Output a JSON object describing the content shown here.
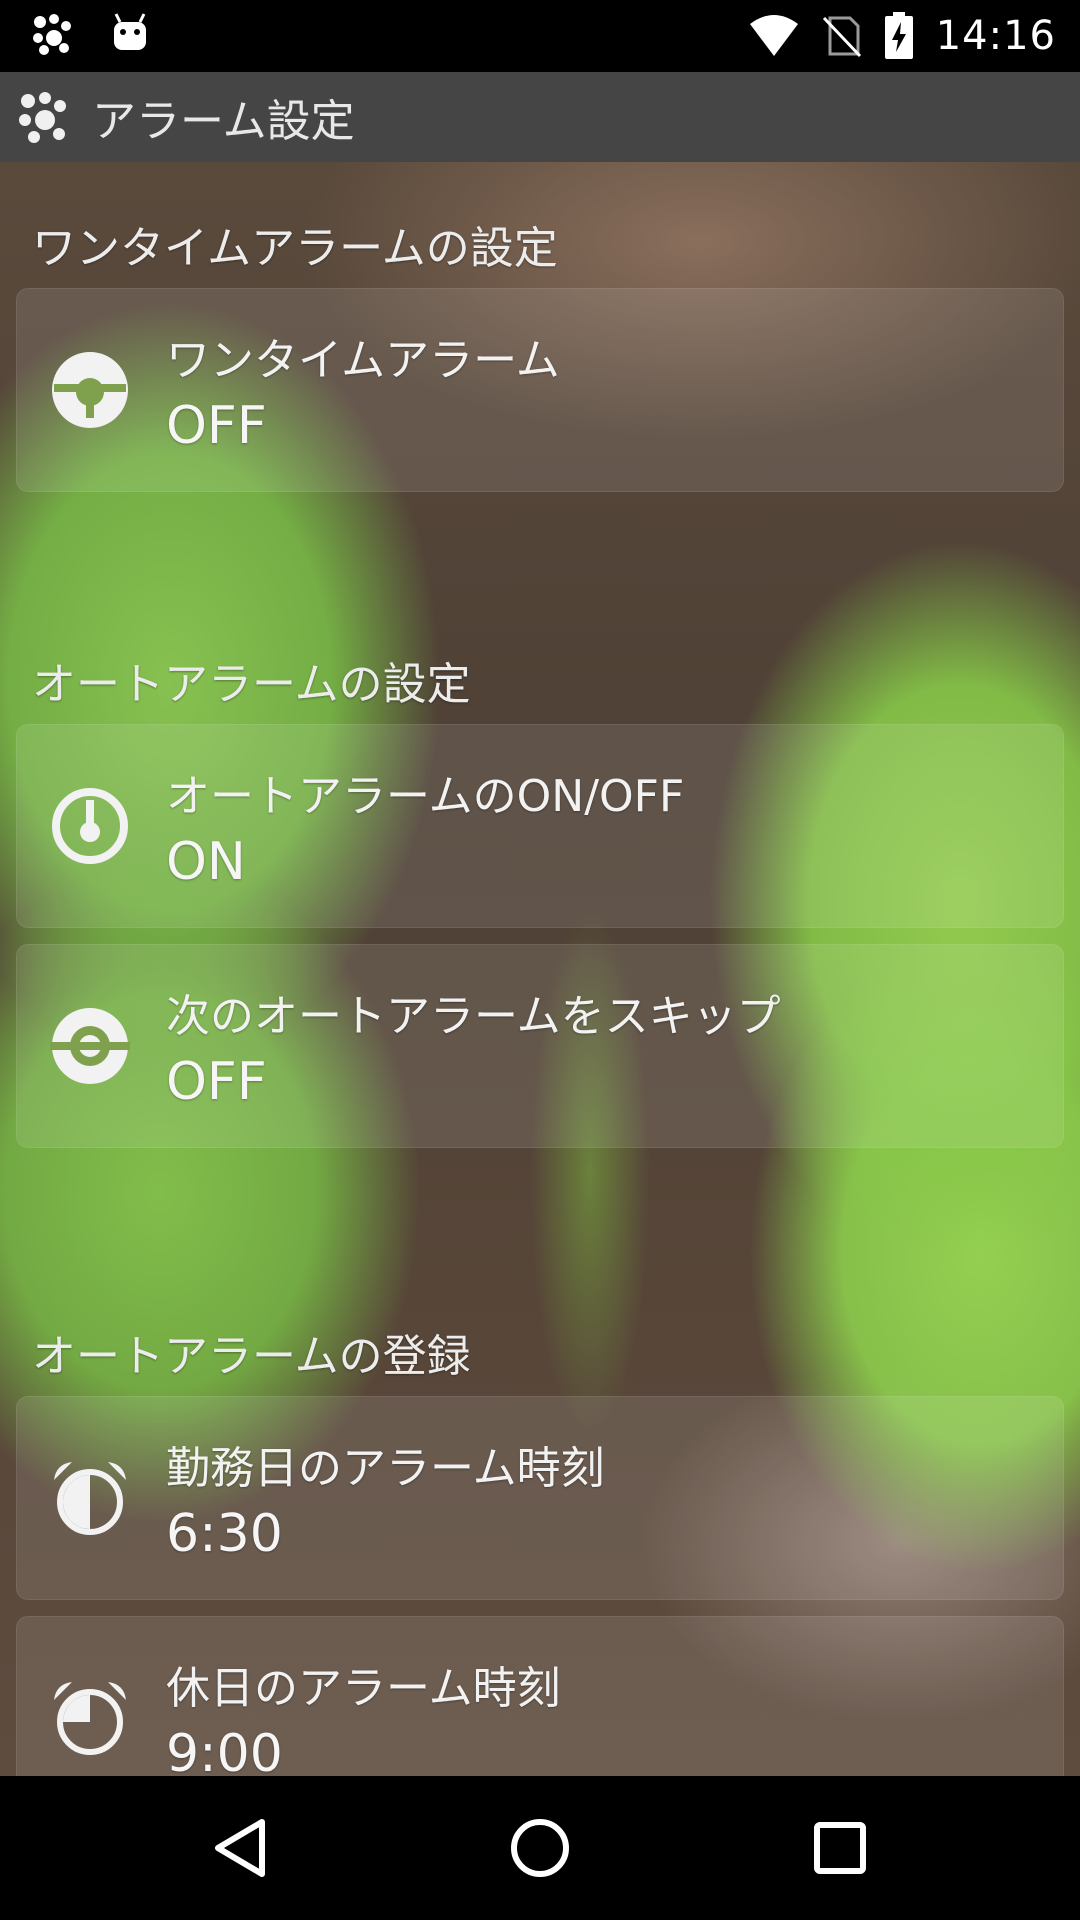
{
  "status_bar": {
    "time": "14:16",
    "left_icons": [
      "app-paw-icon",
      "android-icon"
    ],
    "right_icons": [
      "wifi-icon",
      "no-sim-icon",
      "battery-charging-icon"
    ]
  },
  "app_bar": {
    "title": "アラーム設定",
    "logo_icon": "paw-logo-icon"
  },
  "sections": [
    {
      "header": "ワンタイムアラームの設定",
      "items": [
        {
          "title": "ワンタイムアラーム",
          "value": "OFF",
          "icon": "onetime-alarm-icon"
        }
      ]
    },
    {
      "header": "オートアラームの設定",
      "items": [
        {
          "title": "オートアラームのON/OFF",
          "value": "ON",
          "icon": "power-icon"
        },
        {
          "title": "次のオートアラームをスキップ",
          "value": "OFF",
          "icon": "skip-alarm-icon"
        }
      ]
    },
    {
      "header": "オートアラームの登録",
      "items": [
        {
          "title": "勤務日のアラーム時刻",
          "value": "6:30",
          "icon": "alarm-clock-icon"
        },
        {
          "title": "休日のアラーム時刻",
          "value": "9:00",
          "icon": "alarm-clock-icon"
        }
      ]
    }
  ],
  "nav_bar": {
    "buttons": [
      "back-icon",
      "home-icon",
      "recents-icon"
    ]
  },
  "colors": {
    "status_bar_bg": "#000000",
    "app_bar_bg": "#454545",
    "text_primary": "#f2f2f2"
  }
}
